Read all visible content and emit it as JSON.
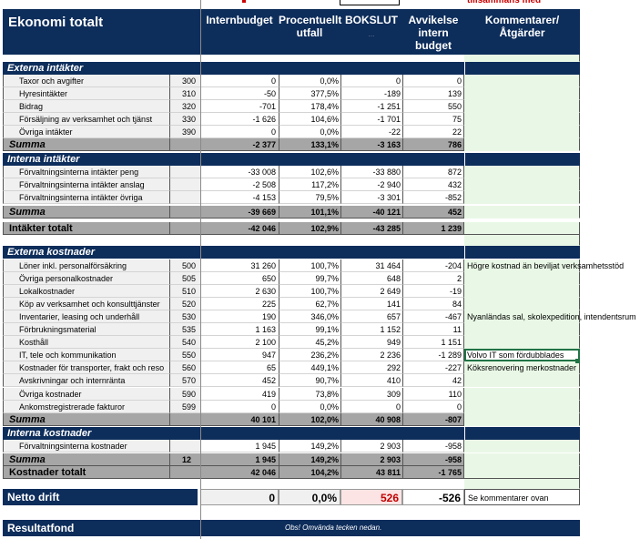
{
  "header": {
    "title": "Ekonomi totalt",
    "col1": "Internbudget",
    "col2": "Procentuellt utfall",
    "col3": "BOKSLUT",
    "col4": "Avvikelse intern budget",
    "col5": "Kommentarer/Åtgärder",
    "col3_sub": "...",
    "top_note": "tillsammans med"
  },
  "colors": {
    "header_bg": "#0d2d5b",
    "sum_bg": "#a6a6a6",
    "comment_bg": "#e9f8e6",
    "highlight": "#fce4e4"
  },
  "externa_intakter": {
    "section": "Externa intäkter",
    "rows": [
      {
        "label": "Taxor och avgifter",
        "code": "300",
        "v1": "0",
        "v2": "0,0%",
        "v3": "0",
        "v4": "0",
        "c": ""
      },
      {
        "label": "Hyresintäkter",
        "code": "310",
        "v1": "-50",
        "v2": "377,5%",
        "v3": "-189",
        "v4": "139",
        "c": ""
      },
      {
        "label": "Bidrag",
        "code": "320",
        "v1": "-701",
        "v2": "178,4%",
        "v3": "-1 251",
        "v4": "550",
        "c": ""
      },
      {
        "label": "Försäljning av verksamhet och tjänst",
        "code": "330",
        "v1": "-1 626",
        "v2": "104,6%",
        "v3": "-1 701",
        "v4": "75",
        "c": ""
      },
      {
        "label": "Övriga intäkter",
        "code": "390",
        "v1": "0",
        "v2": "0,0%",
        "v3": "-22",
        "v4": "22",
        "c": ""
      }
    ],
    "sum": {
      "label": "Summa",
      "code": "",
      "v1": "-2 377",
      "v2": "133,1%",
      "v3": "-3 163",
      "v4": "786",
      "c": ""
    }
  },
  "interna_intakter": {
    "section": "Interna intäkter",
    "rows": [
      {
        "label": "Förvaltningsinterna intäkter peng",
        "code": "",
        "v1": "-33 008",
        "v2": "102,6%",
        "v3": "-33 880",
        "v4": "872",
        "c": ""
      },
      {
        "label": "Förvaltningsinterna intäkter anslag",
        "code": "",
        "v1": "-2 508",
        "v2": "117,2%",
        "v3": "-2 940",
        "v4": "432",
        "c": ""
      },
      {
        "label": "Förvaltningsinterna intäkter övriga",
        "code": "",
        "v1": "-4 153",
        "v2": "79,5%",
        "v3": "-3 301",
        "v4": "-852",
        "c": ""
      }
    ],
    "sum": {
      "label": "Summa",
      "code": "",
      "v1": "-39 669",
      "v2": "101,1%",
      "v3": "-40 121",
      "v4": "452",
      "c": ""
    }
  },
  "intakter_totalt": {
    "label": "Intäkter totalt",
    "code": "",
    "v1": "-42 046",
    "v2": "102,9%",
    "v3": "-43 285",
    "v4": "1 239",
    "c": ""
  },
  "externa_kostnader": {
    "section": "Externa kostnader",
    "rows": [
      {
        "label": "Löner inkl. personalförsäkring",
        "code": "500",
        "v1": "31 260",
        "v2": "100,7%",
        "v3": "31 464",
        "v4": "-204",
        "c": "Högre kostnad än beviljat verksamhetsstöd"
      },
      {
        "label": "Övriga personalkostnader",
        "code": "505",
        "v1": "650",
        "v2": "99,7%",
        "v3": "648",
        "v4": "2",
        "c": ""
      },
      {
        "label": "Lokalkostnader",
        "code": "510",
        "v1": "2 630",
        "v2": "100,7%",
        "v3": "2 649",
        "v4": "-19",
        "c": ""
      },
      {
        "label": "Köp av verksamhet och konsulttjänster",
        "code": "520",
        "v1": "225",
        "v2": "62,7%",
        "v3": "141",
        "v4": "84",
        "c": ""
      },
      {
        "label": "Inventarier, leasing och underhåll",
        "code": "530",
        "v1": "190",
        "v2": "346,0%",
        "v3": "657",
        "v4": "-467",
        "c": "Nyanländas sal, skolexpedition, intendentsrum"
      },
      {
        "label": "Förbrukningsmaterial",
        "code": "535",
        "v1": "1 163",
        "v2": "99,1%",
        "v3": "1 152",
        "v4": "11",
        "c": ""
      },
      {
        "label": "Kosthåll",
        "code": "540",
        "v1": "2 100",
        "v2": "45,2%",
        "v3": "949",
        "v4": "1 151",
        "c": ""
      },
      {
        "label": "IT, tele och kommunikation",
        "code": "550",
        "v1": "947",
        "v2": "236,2%",
        "v3": "2 236",
        "v4": "-1 289",
        "c": "Volvo IT som fördubblades"
      },
      {
        "label": "Kostnader för transporter, frakt och reso",
        "code": "560",
        "v1": "65",
        "v2": "449,1%",
        "v3": "292",
        "v4": "-227",
        "c": "Köksrenovering merkostnader"
      },
      {
        "label": "Avskrivningar och internränta",
        "code": "570",
        "v1": "452",
        "v2": "90,7%",
        "v3": "410",
        "v4": "42",
        "c": ""
      },
      {
        "label": "Övriga kostnader",
        "code": "590",
        "v1": "419",
        "v2": "73,8%",
        "v3": "309",
        "v4": "110",
        "c": ""
      },
      {
        "label": "Ankomstregistrerade fakturor",
        "code": "599",
        "v1": "0",
        "v2": "0,0%",
        "v3": "0",
        "v4": "0",
        "c": ""
      }
    ],
    "sum": {
      "label": "Summa",
      "code": "",
      "v1": "40 101",
      "v2": "102,0%",
      "v3": "40 908",
      "v4": "-807",
      "c": ""
    }
  },
  "interna_kostnader": {
    "section": "Interna kostnader",
    "rows": [
      {
        "label": "Förvaltningsinterna kostnader",
        "code": "",
        "v1": "1 945",
        "v2": "149,2%",
        "v3": "2 903",
        "v4": "-958",
        "c": ""
      }
    ],
    "sum": {
      "label": "Summa",
      "code": "12",
      "v1": "1 945",
      "v2": "149,2%",
      "v3": "2 903",
      "v4": "-958",
      "c": ""
    }
  },
  "kostnader_totalt": {
    "label": "Kostnader totalt",
    "code": "",
    "v1": "42 046",
    "v2": "104,2%",
    "v3": "43 811",
    "v4": "-1 765",
    "c": ""
  },
  "netto": {
    "label": "Netto drift",
    "v1": "0",
    "v2": "0,0%",
    "v3": "526",
    "v4": "-526",
    "c": "Se kommentarer ovan"
  },
  "resultatfond": {
    "label": "Resultatfond",
    "note": "Obs! Omvända tecken nedan."
  }
}
